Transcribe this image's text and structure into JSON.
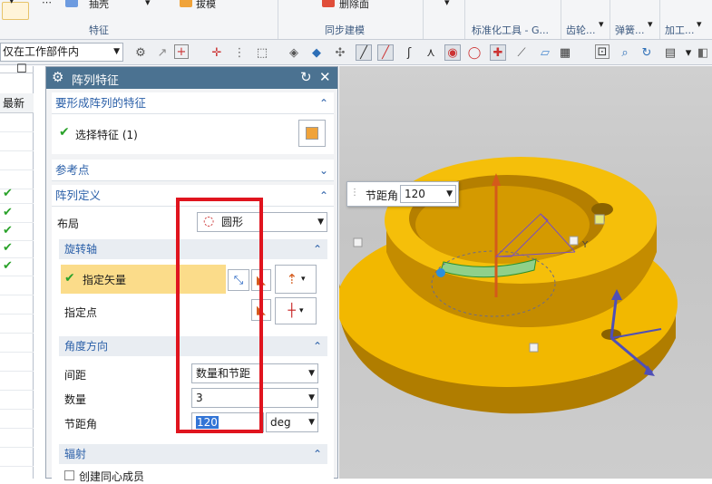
{
  "ribbon": {
    "buttons": {
      "b1": "抽壳",
      "b2": "拔模",
      "b3": "删除面"
    },
    "groups": {
      "feature": "特征",
      "sync": "同步建模",
      "std_tools": "标准化工具 - G...",
      "gear": "齿轮...",
      "spring": "弹簧...",
      "machining": "加工..."
    }
  },
  "selection_bar": {
    "filter_value": "仅在工作部件内"
  },
  "navigator": {
    "header": "最新",
    "checked_rows": 5
  },
  "dialog": {
    "title": "阵列特征",
    "section_features": {
      "title": "要形成阵列的特征",
      "select_label": "选择特征 (1)"
    },
    "section_refpoint": {
      "title": "参考点"
    },
    "section_pattern": {
      "title": "阵列定义",
      "layout_label": "布局",
      "layout_value": "圆形",
      "rotation_axis": {
        "title": "旋转轴",
        "specify_vector": "指定矢量",
        "specify_point": "指定点"
      },
      "angle_direction": {
        "title": "角度方向",
        "spacing_label": "间距",
        "spacing_value": "数量和节距",
        "count_label": "数量",
        "count_value": "3",
        "pitch_label": "节距角",
        "pitch_value": "120",
        "pitch_unit": "deg"
      },
      "radiation": {
        "title": "辐射",
        "checkbox_label": "创建同心成员"
      }
    }
  },
  "viewport": {
    "popup_label": "节距角",
    "popup_value": "120",
    "axis_y": "Y"
  },
  "colors": {
    "title_bar": "#4b7291",
    "part_color": "#f2b800",
    "highlight_row": "#fbdc8a",
    "red_box": "#e0141e"
  }
}
